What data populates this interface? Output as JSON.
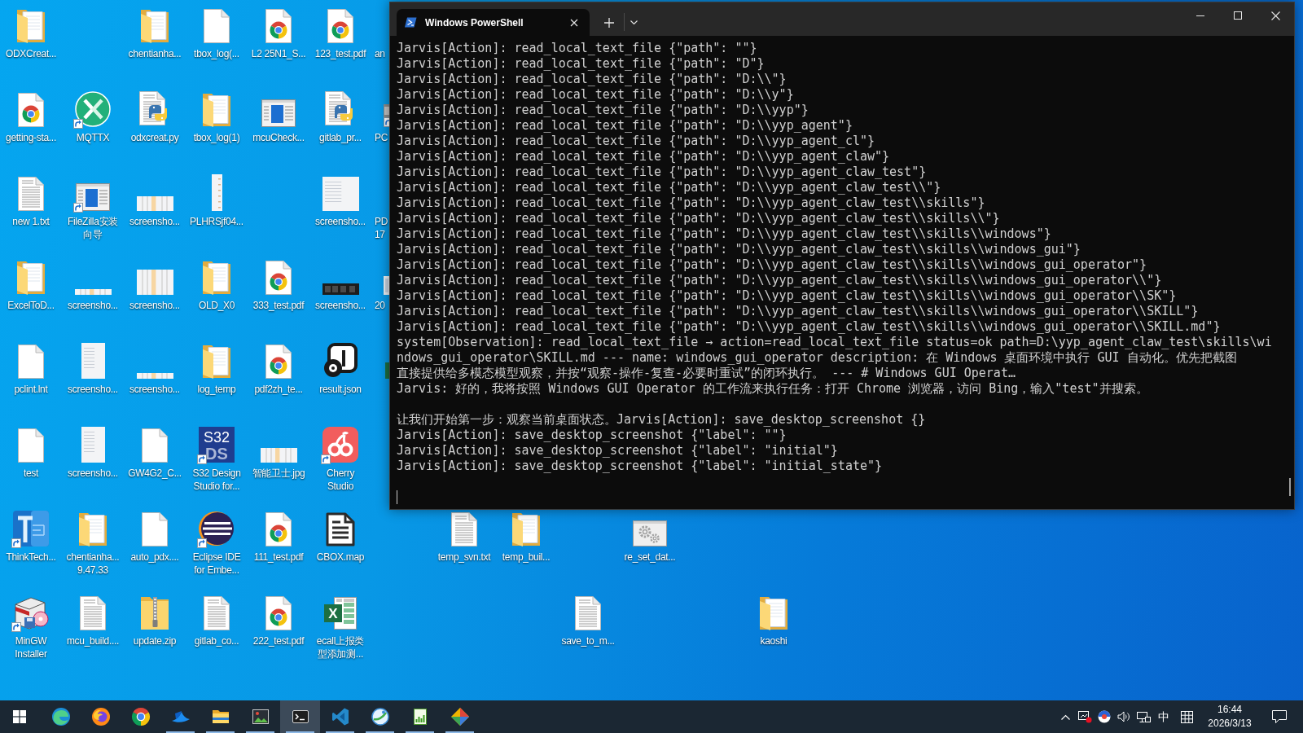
{
  "desktop_icons": [
    {
      "kind": "folder",
      "label": [
        "ODXCreat..."
      ]
    },
    {
      "kind": "folder",
      "label": [
        "chentianha..."
      ]
    },
    {
      "kind": "blank_file",
      "label": [
        "tbox_log(..."
      ]
    },
    {
      "kind": "chrome_file",
      "label": [
        "L2 25N1_S..."
      ]
    },
    {
      "kind": "chrome_file",
      "label": [
        "123_test.pdf"
      ]
    },
    {
      "kind": "chrome_file",
      "label": [
        "getting-sta..."
      ]
    },
    {
      "kind": "mqttx",
      "shortcut": true,
      "label": [
        "MQTTX"
      ]
    },
    {
      "kind": "python_file",
      "label": [
        "odxcreat.py"
      ]
    },
    {
      "kind": "folder",
      "label": [
        "tbox_log(1)"
      ]
    },
    {
      "kind": "app_window",
      "label": [
        "mcuCheck..."
      ]
    },
    {
      "kind": "python_file",
      "label": [
        "gitlab_pr..."
      ]
    },
    {
      "kind": "text_file",
      "label": [
        "new 1.txt"
      ]
    },
    {
      "kind": "app_window",
      "shortcut": true,
      "label": [
        "FileZilla安装",
        "向导"
      ]
    },
    {
      "kind": "image_wide",
      "label": [
        "screensho..."
      ]
    },
    {
      "kind": "image_tall",
      "label": [
        "PLHRSjf04..."
      ]
    },
    {
      "kind": "image_square",
      "label": [
        "screensho..."
      ]
    },
    {
      "kind": "folder",
      "label": [
        "ExcelToD..."
      ]
    },
    {
      "kind": "image_strip",
      "label": [
        "screensho..."
      ]
    },
    {
      "kind": "image_large",
      "label": [
        "screensho..."
      ]
    },
    {
      "kind": "folder",
      "label": [
        "OLD_X0"
      ]
    },
    {
      "kind": "chrome_file",
      "label": [
        "333_test.pdf"
      ]
    },
    {
      "kind": "image_dark",
      "label": [
        "screensho..."
      ]
    },
    {
      "kind": "blank_file",
      "label": [
        "pclint.lnt"
      ]
    },
    {
      "kind": "image_page",
      "label": [
        "screensho..."
      ]
    },
    {
      "kind": "image_strip",
      "label": [
        "screensho..."
      ]
    },
    {
      "kind": "folder",
      "label": [
        "log_temp"
      ]
    },
    {
      "kind": "chrome_file",
      "label": [
        "pdf2zh_te..."
      ]
    },
    {
      "kind": "media_file",
      "label": [
        "result.json"
      ]
    },
    {
      "kind": "blank_file",
      "label": [
        "test"
      ]
    },
    {
      "kind": "image_page",
      "label": [
        "screensho..."
      ]
    },
    {
      "kind": "blank_file",
      "label": [
        "GW4G2_C..."
      ]
    },
    {
      "kind": "s32",
      "shortcut": true,
      "logo": [
        "S32",
        "DS"
      ],
      "label": [
        "S32 Design",
        "Studio for..."
      ]
    },
    {
      "kind": "image_wide",
      "label": [
        "智能卫士.jpg"
      ]
    },
    {
      "kind": "cherry",
      "shortcut": true,
      "label": [
        "Cherry",
        "Studio"
      ]
    },
    {
      "kind": "thinktech",
      "shortcut": true,
      "label": [
        "ThinkTech..."
      ]
    },
    {
      "kind": "folder",
      "label": [
        "chentianha...",
        "9.47.33"
      ]
    },
    {
      "kind": "blank_file",
      "label": [
        "auto_pdx...."
      ]
    },
    {
      "kind": "eclipse",
      "shortcut": true,
      "label": [
        "Eclipse IDE",
        "for Embe..."
      ]
    },
    {
      "kind": "chrome_file",
      "label": [
        "111_test.pdf"
      ]
    },
    {
      "kind": "document",
      "label": [
        "CBOX.map"
      ]
    },
    {
      "kind": "text_file",
      "label": [
        "temp_svn.txt"
      ]
    },
    {
      "kind": "folder",
      "label": [
        "temp_buil..."
      ]
    },
    {
      "kind": "settings_window",
      "label": [
        "re_set_dat..."
      ]
    },
    {
      "kind": "mingw",
      "shortcut": true,
      "label": [
        "MinGW",
        "Installer"
      ]
    },
    {
      "kind": "text_file",
      "label": [
        "mcu_build...."
      ]
    },
    {
      "kind": "zip_folder",
      "label": [
        "update.zip"
      ]
    },
    {
      "kind": "text_file",
      "label": [
        "gitlab_co..."
      ]
    },
    {
      "kind": "chrome_file",
      "label": [
        "222_test.pdf"
      ]
    },
    {
      "kind": "excel",
      "logo": [
        "X"
      ],
      "label": [
        "ecall上报类",
        "型添加测..."
      ]
    },
    {
      "kind": "text_file",
      "label": [
        "save_to_m..."
      ]
    },
    {
      "kind": "folder",
      "label": [
        "kaoshi"
      ]
    }
  ],
  "desktop_icons_cut_off": [
    {
      "label": [
        "an"
      ]
    },
    {
      "kind": "app",
      "shortcut": true,
      "label": [
        "PC"
      ]
    },
    {
      "label": [
        "PD",
        "17"
      ]
    },
    {
      "kind": "image",
      "label": [
        "20"
      ]
    },
    {
      "kind": "spreadsheet"
    }
  ],
  "terminal": {
    "tab": {
      "title": "Windows PowerShell",
      "selected": true
    },
    "output": [
      [
        "Jarvis[Action]: read_local_text_file {\"path\": \"\"}",
        "Jarvis[Action]: read_local_text_file {\"path\": \"D\"}",
        "Jarvis[Action]: read_local_text_file {\"path\": \"D:\\\\\"}",
        "Jarvis[Action]: read_local_text_file {\"path\": \"D:\\\\y\"}",
        "Jarvis[Action]: read_local_text_file {\"path\": \"D:\\\\yyp\"}",
        "Jarvis[Action]: read_local_text_file {\"path\": \"D:\\\\yyp_agent\"}",
        "Jarvis[Action]: read_local_text_file {\"path\": \"D:\\\\yyp_agent_cl\"}",
        "Jarvis[Action]: read_local_text_file {\"path\": \"D:\\\\yyp_agent_claw\"}",
        "Jarvis[Action]: read_local_text_file {\"path\": \"D:\\\\yyp_agent_claw_test\"}",
        "Jarvis[Action]: read_local_text_file {\"path\": \"D:\\\\yyp_agent_claw_test\\\\\"}",
        "Jarvis[Action]: read_local_text_file {\"path\": \"D:\\\\yyp_agent_claw_test\\\\skills\"}",
        "Jarvis[Action]: read_local_text_file {\"path\": \"D:\\\\yyp_agent_claw_test\\\\skills\\\\\"}",
        "Jarvis[Action]: read_local_text_file {\"path\": \"D:\\\\yyp_agent_claw_test\\\\skills\\\\windows\"}",
        "Jarvis[Action]: read_local_text_file {\"path\": \"D:\\\\yyp_agent_claw_test\\\\skills\\\\windows_gui\"}",
        "Jarvis[Action]: read_local_text_file {\"path\": \"D:\\\\yyp_agent_claw_test\\\\skills\\\\windows_gui_operator\"}",
        "Jarvis[Action]: read_local_text_file {\"path\": \"D:\\\\yyp_agent_claw_test\\\\skills\\\\windows_gui_operator\\\\\"}",
        "Jarvis[Action]: read_local_text_file {\"path\": \"D:\\\\yyp_agent_claw_test\\\\skills\\\\windows_gui_operator\\\\SK\"}",
        "Jarvis[Action]: read_local_text_file {\"path\": \"D:\\\\yyp_agent_claw_test\\\\skills\\\\windows_gui_operator\\\\SKILL\"}",
        "Jarvis[Action]: read_local_text_file {\"path\": \"D:\\\\yyp_agent_claw_test\\\\skills\\\\windows_gui_operator\\\\SKILL.md\"}",
        "system[Observation]: read_local_text_file → action=read_local_text_file status=ok path=D:\\yyp_agent_claw_test\\skills\\wi",
        "ndows_gui_operator\\SKILL.md --- name: windows_gui_operator description: 在 Windows 桌面环境中执行 GUI 自动化。优先把截图",
        "直接提供给多模态模型观察，并按“观察-操作-复查-必要时重试”的闭环执行。 --- # Windows GUI Operat…",
        "Jarvis: 好的，我将按照 Windows GUI Operator 的工作流来执行任务：打开 Chrome 浏览器，访问 Bing，输入\"test\"并搜索。"
      ],
      [
        "让我们开始第一步：观察当前桌面状态。Jarvis[Action]: save_desktop_screenshot {}",
        "Jarvis[Action]: save_desktop_screenshot {\"label\": \"\"}",
        "Jarvis[Action]: save_desktop_screenshot {\"label\": \"initial\"}",
        "Jarvis[Action]: save_desktop_screenshot {\"label\": \"initial_state\"}"
      ]
    ]
  },
  "taskbar": {
    "apps": [
      {
        "kind": "edge",
        "running": false,
        "selected": false
      },
      {
        "kind": "firefox",
        "running": false,
        "selected": false
      },
      {
        "kind": "chrome",
        "running": false,
        "selected": false
      },
      {
        "kind": "wing_app",
        "running": true,
        "selected": false
      },
      {
        "kind": "file_explorer",
        "running": true,
        "selected": false
      },
      {
        "kind": "image_app",
        "running": true,
        "selected": false
      },
      {
        "kind": "terminal",
        "running": true,
        "selected": true
      },
      {
        "kind": "code_editor",
        "running": true,
        "selected": false
      },
      {
        "kind": "globe_app",
        "running": true,
        "selected": false
      },
      {
        "kind": "chart_app",
        "running": true,
        "selected": false
      },
      {
        "kind": "diamond_app",
        "running": true,
        "selected": false
      }
    ],
    "tray": {
      "input_mode": "中",
      "time": "16:44",
      "date": "2026/3/13"
    }
  }
}
